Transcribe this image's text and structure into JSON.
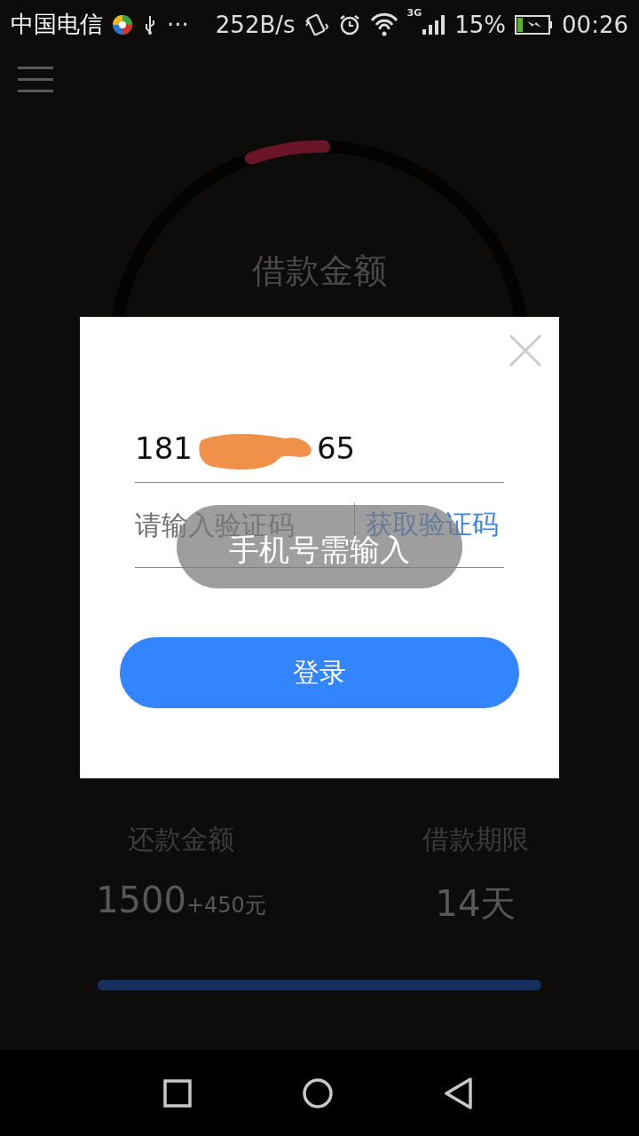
{
  "status_bar": {
    "carrier": "中国电信",
    "overflow": "···",
    "net_speed": "252B/s",
    "network_type": "3G",
    "battery": "15%",
    "time": "00:26"
  },
  "loan": {
    "title": "借款金额",
    "repay_label": "还款金额",
    "repay_amount": "1500",
    "repay_extra": "+450元",
    "term_label": "借款期限",
    "term_value": "14天",
    "progress": {
      "level": 1
    }
  },
  "dialog": {
    "phone": {
      "start": "181",
      "end": "65"
    },
    "code": {
      "placeholder": "请输入验证码",
      "action": "获取验证码"
    },
    "login_button": "登录",
    "toast": "手机号需输入"
  }
}
